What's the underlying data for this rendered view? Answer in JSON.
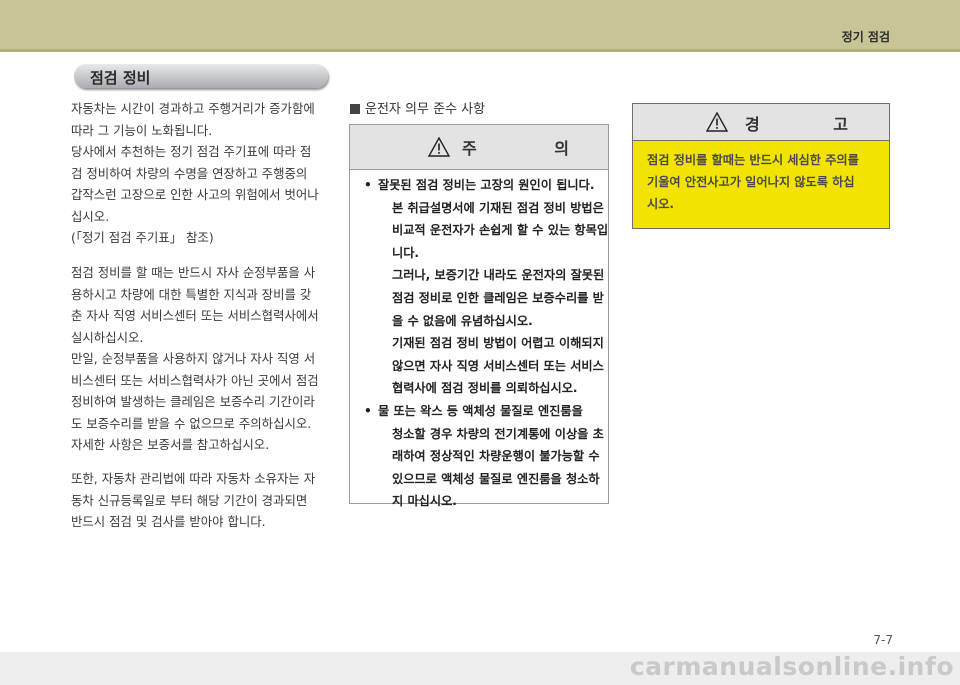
{
  "header": {
    "title": "정기 점검"
  },
  "section": {
    "title": "점검 정비"
  },
  "left_column": {
    "para1_lines": [
      "자동차는 시간이 경과하고 주행거리가 증가함에",
      "따라 그 기능이 노화됩니다.",
      "당사에서 추천하는 정기 점검 주기표에 따라 점",
      "검 정비하여 차량의 수명을 연장하고 주행중의",
      "갑작스런 고장으로 인한 사고의 위험에서 벗어나",
      "십시오.",
      "(「정기 점검 주기표」 참조)"
    ],
    "para2_lines": [
      "점검 정비를 할 때는 반드시 자사 순정부품을 사",
      "용하시고 차량에 대한 특별한 지식과 장비를 갖",
      "춘 자사 직영 서비스센터 또는 서비스협력사에서",
      "실시하십시오.",
      "만일, 순정부품을 사용하지 않거나 자사 직영 서",
      "비스센터 또는 서비스협력사가 아닌 곳에서 점검",
      "정비하여 발생하는 클레임은 보증수리 기간이라",
      "도 보증수리를 받을 수 없으므로 주의하십시오.",
      "자세한 사항은 보증서를 참고하십시오."
    ],
    "para3_lines": [
      "또한, 자동차 관리법에 따라 자동차 소유자는 자",
      "동차 신규등록일로 부터 해당 기간이 경과되면",
      "반드시 점검 및 검사를 받아야 합니다."
    ]
  },
  "middle_column": {
    "heading": "운전자 의무 준수 사항",
    "caution": {
      "label": "주 의",
      "bullet": "•",
      "item1_lines": [
        "잘못된 점검 정비는 고장의 원인이 됩니다.",
        "본 취급설명서에 기재된 점검 정비 방법은",
        "비교적 운전자가 손쉽게 할 수 있는 항목입",
        "니다.",
        "그러나, 보증기간 내라도 운전자의 잘못된",
        "점검 정비로 인한 클레임은 보증수리를 받",
        "을 수 없음에 유념하십시오.",
        "기재된 점검 정비 방법이 어렵고 이해되지",
        "않으면 자사 직영 서비스센터 또는 서비스",
        "협력사에 점검 정비를 의뢰하십시오."
      ],
      "item2_lines": [
        "물 또는 왁스 등 액체성 물질로 엔진룸을",
        "청소할 경우 차량의 전기계통에 이상을 초",
        "래하여 정상적인 차량운행이 불가능할 수",
        "있으므로 액체성 물질로 엔진룸을 청소하",
        "지 마십시오."
      ]
    }
  },
  "right_column": {
    "warning": {
      "label": "경 고",
      "lines": [
        "점검 정비를 할때는 반드시 세심한 주의를",
        "기울여 안전사고가 일어나지 않도록 하십",
        "시오."
      ]
    }
  },
  "page_number": "7-7",
  "watermark": "carmanualsonline.info",
  "colors": {
    "header": "#c7c596",
    "warning_bg": "#f3e400",
    "caution_head": "#e3e3e3"
  },
  "icons": {
    "caution": "warning-triangle-icon",
    "warning": "warning-triangle-icon",
    "heading_bullet": "square-bullet-icon"
  }
}
